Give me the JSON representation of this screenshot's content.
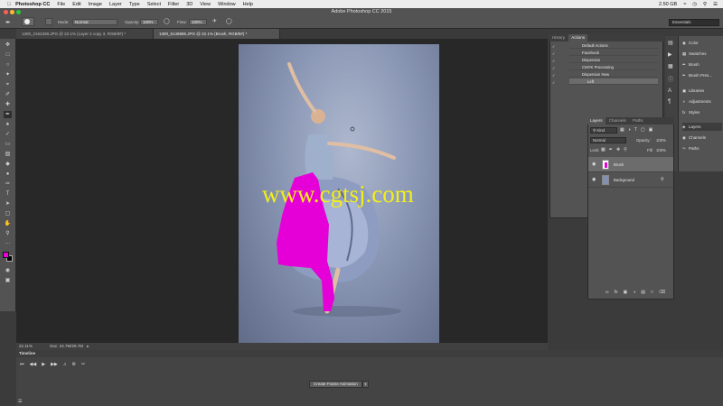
{
  "menubar": {
    "app": "Photoshop CC",
    "items": [
      "File",
      "Edit",
      "Image",
      "Layer",
      "Type",
      "Select",
      "Filter",
      "3D",
      "View",
      "Window",
      "Help"
    ],
    "memory": "2.50 GB"
  },
  "window": {
    "title": "Adobe Photoshop CC 2015"
  },
  "options": {
    "mode_label": "Mode:",
    "mode_value": "Normal",
    "opacity_label": "Opacity:",
    "opacity_value": "100%",
    "flow_label": "Flow:",
    "flow_value": "100%",
    "brush_size": "100",
    "workspace": "Essentials"
  },
  "doc_tabs": [
    {
      "label": "1300_2162338.JPG @ 22.1% (Layer 2 copy 3, RGB/8#) *"
    },
    {
      "label": "1300_5148985.JPG @ 22.1% (Brush, RGB/8#) *"
    }
  ],
  "statusbar": {
    "zoom": "22.11%",
    "doc": "Doc: 24.7M/29.7M"
  },
  "timeline": {
    "title": "Timeline",
    "create_button": "Create Frame Animation"
  },
  "actions_panel": {
    "tabs": [
      "History",
      "Actions"
    ],
    "rows": [
      "Default Actions",
      "Facebook",
      "Dispersion",
      "CMYK Processing",
      "Dispersion New",
      "Left"
    ]
  },
  "layers_panel": {
    "tabs": [
      "Layers",
      "Channels",
      "Paths"
    ],
    "filter": "Kind",
    "blend": "Normal",
    "opacity_label": "Opacity:",
    "opacity_value": "100%",
    "lock_label": "Lock:",
    "fill_label": "Fill:",
    "fill_value": "100%",
    "layers": [
      "Brush",
      "Background"
    ]
  },
  "dock": {
    "group1": [
      "Color",
      "Swatches",
      "Brush",
      "Brush Pres..."
    ],
    "group2": [
      "Libraries",
      "Adjustments",
      "Styles"
    ],
    "group3": [
      "Layers",
      "Channels",
      "Paths"
    ]
  },
  "watermark": "www.cgtsj.com",
  "colors": {
    "foreground": "#e600d8",
    "accent": "#f3ef18"
  }
}
